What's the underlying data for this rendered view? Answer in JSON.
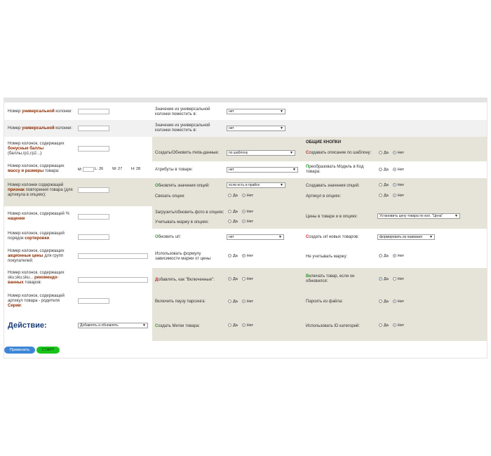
{
  "rows": [
    {
      "left": {
        "pre": "Номер ",
        "hl": "универсальной",
        "post": " колонки:"
      },
      "mid": {
        "label": "Значение из универсальной колонки поместить в:",
        "select": "нет"
      }
    },
    {
      "left": {
        "pre": "Номер ",
        "hl": "универсальной",
        "post": " колонки:"
      },
      "mid": {
        "label": "Значение из универсальной колонки поместить в:",
        "select": "нет"
      }
    },
    {
      "left": {
        "pre": "Номер колонок, содержащих ",
        "hl": "бонусные баллы",
        "post": " (баллы,гр1,гр2...):"
      },
      "mid": {
        "label": "Создать/Обновить meta-данные:",
        "select": "по шаблону"
      },
      "right": {
        "header": "ОБЩИЕ КНОПКИ",
        "label_first": "С",
        "label_rest": "оздавать описание по шаблону:",
        "yes": "Да",
        "no": "Нет"
      }
    },
    {
      "left": {
        "pre": "Номер колонок, содержащих ",
        "hl": "массу и размеры",
        "post": " товара:"
      },
      "dims": [
        "M:",
        "L: 26",
        "W: 27",
        "H: 28"
      ],
      "mid": {
        "label": "Атрибуты в товаре:",
        "select": "нет"
      },
      "right": {
        "label_first": "П",
        "label_rest": "реобразовать Модель в Код товара:",
        "yes": "Да",
        "no": "Нет"
      }
    },
    {
      "left": {
        "pre": "Номер колонки содержащей ",
        "hl": "признак",
        "post": " повторения товара (для артикула в опциях):"
      },
      "mid": {
        "label_first": "О",
        "label_rest": "бновлять значения опций:",
        "select": "если есть в прайсе",
        "label2": "Связать опции:",
        "yes": "Да",
        "no": "Нет"
      },
      "right": {
        "label": "Создавать значения опций:",
        "yes": "Да",
        "no": "Нет",
        "label2": "Артикул в опциях:",
        "yes2": "Да",
        "no2": "Нет"
      }
    },
    {
      "left": {
        "pre": "Номер колонок, содержащей % ",
        "hl": "наценки",
        "post": ""
      },
      "mid": {
        "label": "Загрузить/обновить фото в опциях:",
        "yes": "Да",
        "no": "Нет",
        "label2": "Учитывать маржу в опциях:",
        "yes2": "Да",
        "no2": "Нет"
      },
      "right": {
        "label": "Цены в товаре и в опциях:",
        "select": "Установить цену товара по кол. \"Цена\""
      }
    },
    {
      "left": {
        "pre": "Номер колонок, содержащей порядок ",
        "hl": "сортировки",
        "post": ""
      },
      "mid": {
        "label_first": "О",
        "label_rest": "бновить url:",
        "select": "нет"
      },
      "right": {
        "label_first": "С",
        "label_rest": "оздать url новых товаров:",
        "select": "формировать из названия"
      }
    },
    {
      "left": {
        "pre": "Номер колонок, содержащих ",
        "hl": "акционные цены",
        "post": " для групп покупателей:"
      },
      "mid": {
        "label": "Использовать формулу зависимости маржи от цены:",
        "yes": "Да",
        "no": "Нет"
      },
      "right": {
        "label": "Не учитывать маржу:",
        "yes": "Да",
        "no": "Нет"
      }
    },
    {
      "left": {
        "pre": "Номер колонок, содержащих sku;sku;sku... ",
        "hl": "рекомендо-ванных",
        "post": " товаров:"
      },
      "mid": {
        "label_first": "Д",
        "label_rest": "обавлять, как \"Включенные\":",
        "yes": "Да",
        "no": "Нет"
      },
      "right": {
        "label_first": "В",
        "label_rest": "ключать товар, если он обновился:",
        "yes": "Да",
        "no": "Нет"
      }
    },
    {
      "left": {
        "pre": "Номер колонок, содержащей артикул товара - родителя ",
        "hl": "Серии",
        "post": ":"
      },
      "mid": {
        "label": "Включить паузу парсинга:",
        "yes": "Да",
        "no": "Нет"
      },
      "right": {
        "label": "Парсить из файла:",
        "yes": "Да",
        "no": "Нет"
      }
    },
    {
      "mid": {
        "label_first": "С",
        "label_rest": "оздать Метки товара:",
        "yes": "Да",
        "no": "Нет"
      },
      "right": {
        "label": "Использовать ID категорий:",
        "yes": "Да",
        "no": "Нет"
      }
    }
  ],
  "action": {
    "label": "Действие:",
    "select": "Добавлять и обновлять"
  },
  "buttons": {
    "apply": "Применить",
    "start": "СТАРТ"
  }
}
